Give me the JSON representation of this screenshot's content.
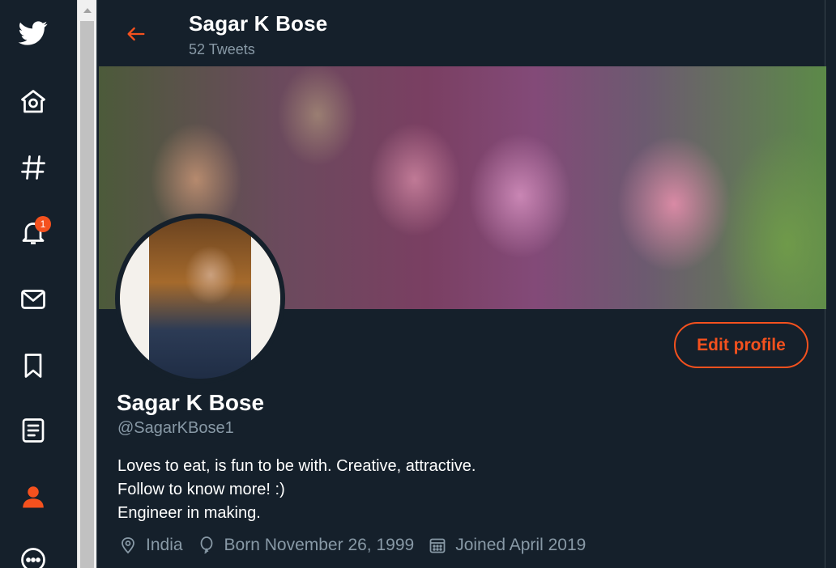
{
  "colors": {
    "background": "#15202b",
    "accent": "#f4511e",
    "muted": "#8899a6",
    "text": "#ffffff"
  },
  "nav": {
    "items": [
      {
        "name": "twitter-logo",
        "icon": "twitter-bird-icon"
      },
      {
        "name": "home",
        "icon": "home-icon"
      },
      {
        "name": "explore",
        "icon": "hashtag-icon"
      },
      {
        "name": "notifications",
        "icon": "bell-icon",
        "badge": "1"
      },
      {
        "name": "messages",
        "icon": "envelope-icon"
      },
      {
        "name": "bookmarks",
        "icon": "bookmark-icon"
      },
      {
        "name": "lists",
        "icon": "list-icon"
      },
      {
        "name": "profile",
        "icon": "person-icon",
        "active": true
      },
      {
        "name": "more",
        "icon": "more-icon"
      }
    ]
  },
  "header": {
    "name": "Sagar K Bose",
    "tweet_count": "52 Tweets",
    "back_icon": "arrow-left-icon"
  },
  "profile": {
    "edit_button": "Edit profile",
    "name": "Sagar K Bose",
    "handle": "@SagarKBose1",
    "bio": [
      "Loves to eat, is fun to be with. Creative, attractive.",
      "Follow to know more! :)",
      "Engineer in making."
    ],
    "location": "India",
    "born": "Born November 26, 1999",
    "joined": "Joined April 2019"
  }
}
